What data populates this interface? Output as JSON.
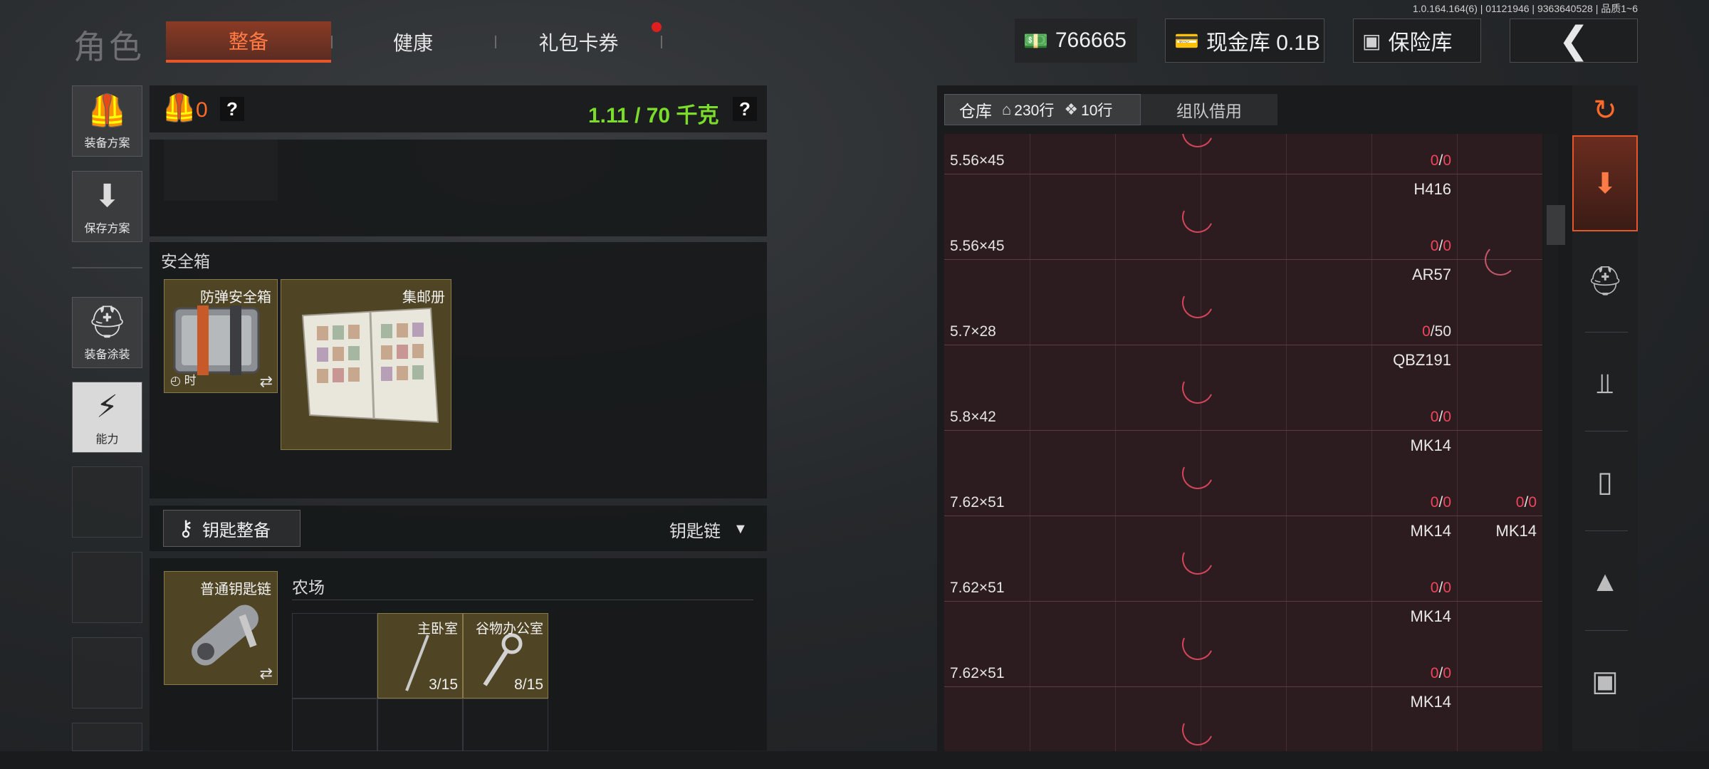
{
  "version": "1.0.164.164(6) | 01121946 | 9363640528 | 品质1~6",
  "header": {
    "title": "角色",
    "tabs": [
      {
        "label": "整备",
        "active": true
      },
      {
        "label": "健康",
        "active": false
      },
      {
        "label": "礼包卡券",
        "active": false,
        "badge": "red-dot"
      }
    ],
    "money": "766665",
    "cash_vault": "现金库 0.1B",
    "insurance": "保险库",
    "back_icon": "chevron-left-icon"
  },
  "rail": {
    "items": [
      {
        "label": "装备方案",
        "icon": "vest-icon"
      },
      {
        "label": "保存方案",
        "icon": "download-icon"
      },
      {
        "label": "装备涂装",
        "icon": "helmet-icon"
      },
      {
        "label": "能力",
        "icon": "lightning-hex-icon"
      }
    ]
  },
  "loadout": {
    "vest_count": "0",
    "weight": "1.11 / 70 千克",
    "help": "?"
  },
  "safe": {
    "label": "安全箱",
    "items": [
      {
        "name": "防弹安全箱",
        "timer": "时"
      },
      {
        "name": "集邮册"
      }
    ]
  },
  "keys": {
    "gear_button": "钥匙整备",
    "keychain_select": "钥匙链",
    "keychain_item": "普通钥匙链",
    "location": "农场",
    "slots": [
      {
        "name": "主卧室",
        "count": "3/15"
      },
      {
        "name": "谷物办公室",
        "count": "8/15"
      }
    ]
  },
  "stash": {
    "tab_label": "仓库",
    "rows_label": "230行",
    "extra_label": "10行",
    "team_tab": "组队借用",
    "rows": [
      {
        "name": "",
        "caliber": "5.56×45",
        "ammo_a": "0",
        "ammo_b": "0"
      },
      {
        "name": "H416",
        "caliber": "5.56×45",
        "ammo_a": "0",
        "ammo_b": "0"
      },
      {
        "name": "AR57",
        "caliber": "5.7×28",
        "ammo_a": "0",
        "ammo_b": "50"
      },
      {
        "name": "QBZ191",
        "caliber": "5.8×42",
        "ammo_a": "0",
        "ammo_b": "0"
      },
      {
        "name": "MK14",
        "caliber": "7.62×51",
        "ammo_a": "0",
        "ammo_b": "0",
        "extra_ammo_a": "0",
        "extra_ammo_b": "0"
      },
      {
        "name": "MK14",
        "caliber": "7.62×51",
        "ammo_a": "0",
        "ammo_b": "0",
        "extra_name": "MK14"
      },
      {
        "name": "MK14",
        "caliber": "7.62×51",
        "ammo_a": "0",
        "ammo_b": "0"
      },
      {
        "name": "MK14",
        "caliber": "",
        "ammo_a": "",
        "ammo_b": ""
      }
    ]
  },
  "categories": [
    "stack-refresh-icon",
    "sort-icon",
    "helmet-icon",
    "rifle-icon",
    "magazine-icon",
    "ammo-icon",
    "scope-icon"
  ],
  "colors": {
    "accent": "#e5562a",
    "weight_ok": "#7bdc2c",
    "ammo_zero": "#f0465a"
  }
}
